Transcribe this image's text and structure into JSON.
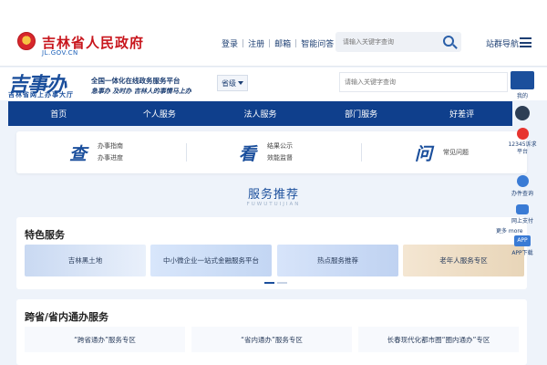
{
  "header": {
    "site_title": "吉林省人民政府",
    "site_url": "JL.GOV.CN",
    "links": [
      "登录",
      "注册",
      "邮箱",
      "智能问答"
    ],
    "search_placeholder": "请输入关键字查询",
    "sitenav": "站群导航"
  },
  "brand": {
    "logo": "吉事办",
    "sub": "吉林省网上办事大厅",
    "slogan1": "全国一体化在线政务服务平台",
    "slogan2": "急事办 及时办 吉林人的事情马上办",
    "region": "省级",
    "search_placeholder": "请输入关键字查询"
  },
  "nav": [
    "首页",
    "个人服务",
    "法人服务",
    "部门服务",
    "好差评"
  ],
  "quick": [
    {
      "big": "查",
      "links": [
        "办事指南",
        "办事进度"
      ]
    },
    {
      "big": "看",
      "links": [
        "结果公示",
        "效能监督"
      ]
    },
    {
      "big": "问",
      "links": [
        "常见问题"
      ]
    }
  ],
  "recommend": {
    "title": "服务推荐",
    "sub": "FUWUTUIJIAN"
  },
  "featured": {
    "title": "特色服务",
    "cards": [
      "吉林黑土地",
      "中小微企业一站式金融服务平台",
      "热点服务推荐",
      "老年人服务专区"
    ]
  },
  "cross": {
    "title": "跨省/省内通办服务",
    "items": [
      "“跨省通办”服务专区",
      "“省内通办”服务专区",
      "长春现代化都市圈“圈内通办”专区"
    ]
  },
  "side": {
    "items": [
      "我的",
      "12345诉求平台",
      "办件查询",
      "网上支付",
      "APP下载"
    ],
    "more": "更多 more",
    "app_badge": "APP"
  },
  "colors": {
    "primary": "#0f3f8c",
    "accent": "#c8161d",
    "brand": "#1b4f9c"
  }
}
